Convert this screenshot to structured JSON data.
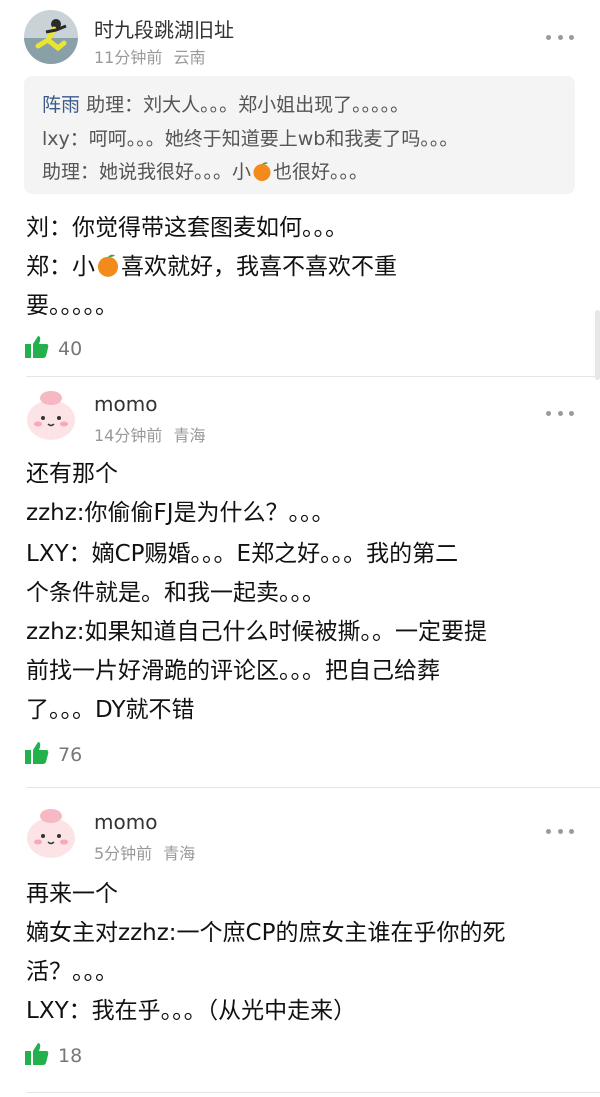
{
  "comments": [
    {
      "username": "时九段跳湖旧址",
      "time": "11分钟前",
      "location": "云南",
      "quote_lines": [
        {
          "name": "阵雨",
          "text": "助理：刘大人。。。郑小姐出现了。。。。。"
        },
        {
          "text": "lxy：呵呵。。。她终于知道要上wb和我麦了吗。。。"
        },
        {
          "text_before": "助理：她说我很好。。。小",
          "text_after": "也很好。。。"
        }
      ],
      "body_lines": [
        {
          "text": "刘：你觉得带这套图麦如何。。。"
        },
        {
          "text_before": "郑：小",
          "text_after": "喜欢就好，我喜不喜欢不重"
        },
        {
          "text": "要。。。。。"
        }
      ],
      "likes": "40"
    },
    {
      "username": "momo",
      "time": "14分钟前",
      "location": "青海",
      "body_lines": [
        "还有那个",
        "zzhz:你偷偷FJ是为什么？。。。",
        "LXY：嫡CP赐婚。。。E郑之好。。。我的第二",
        "个条件就是。和我一起卖。。。",
        "zzhz:如果知道自己什么时候被撕。。一定要提",
        "前找一片好滑跪的评论区。。。把自己给葬",
        "了。。。DY就不错"
      ],
      "likes": "76"
    },
    {
      "username": "momo",
      "time": "5分钟前",
      "location": "青海",
      "body_lines": [
        "再来一个",
        "嫡女主对zzhz:一个庶CP的庶女主谁在乎你的死",
        "活？。。。",
        "LXY：我在乎。。。（从光中走来）"
      ],
      "likes": "18"
    }
  ],
  "icons": {
    "like": "thumbs-up-icon",
    "more": "more-dots-icon",
    "emoji": "orange-fruit-emoji"
  },
  "colors": {
    "like_green": "#22b14c",
    "meta_gray": "#999999",
    "quote_bg": "#f4f4f4"
  }
}
